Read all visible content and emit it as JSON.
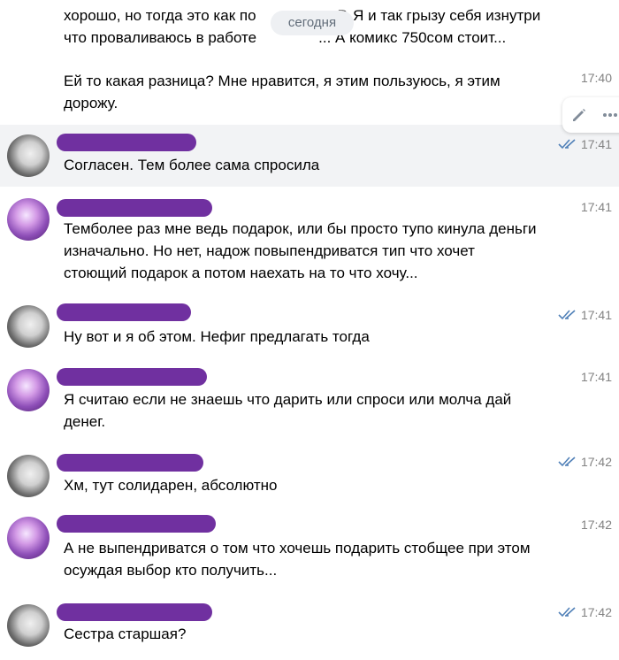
{
  "date_divider": "сегодня",
  "top_message": {
    "line1a": "хорошо, но тогда это как по",
    "line1b": "Р. Я и так грызу себя изнутри",
    "line2a": "что проваливаюсь в работе",
    "line2b": "... А комикс 750сом стоит...",
    "line3": "Ей то какая разница? Мне нравится, я этим пользуюсь, я этим",
    "line4": "дорожу.",
    "time": "17:40"
  },
  "messages": [
    {
      "lines": [
        "Согласен. Тем более сама спросила"
      ],
      "time": "17:41",
      "read": true
    },
    {
      "lines": [
        "Темболее раз мне ведь подарок, или бы просто тупо кинула деньги",
        "изначально. Но нет, надож повыпендриватся тип что хочет",
        "стоющий подарок а потом наехать на то что хочу..."
      ],
      "time": "17:41",
      "read": false
    },
    {
      "lines": [
        "Ну вот и я об этом. Нефиг предлагать тогда"
      ],
      "time": "17:41",
      "read": true
    },
    {
      "lines": [
        "Я считаю если не знаешь что дарить или спроси или молча дай",
        "денег."
      ],
      "time": "17:41",
      "read": false
    },
    {
      "lines": [
        "Хм, тут солидарен, абсолютно"
      ],
      "time": "17:42",
      "read": true
    },
    {
      "lines": [
        "А не выпендриватся о том что хочешь подарить стобщее при этом",
        "осуждая выбор кто получить..."
      ],
      "time": "17:42",
      "read": false
    },
    {
      "lines": [
        "Сестра старшая?"
      ],
      "time": "17:42",
      "read": true
    }
  ],
  "colors": {
    "check": "#5181b8",
    "redaction": "#7030a0",
    "time": "#828282",
    "highlight": "#f2f3f5"
  },
  "icons": {
    "edit": "pencil-icon",
    "more": "more-icon",
    "read": "double-check-icon"
  }
}
